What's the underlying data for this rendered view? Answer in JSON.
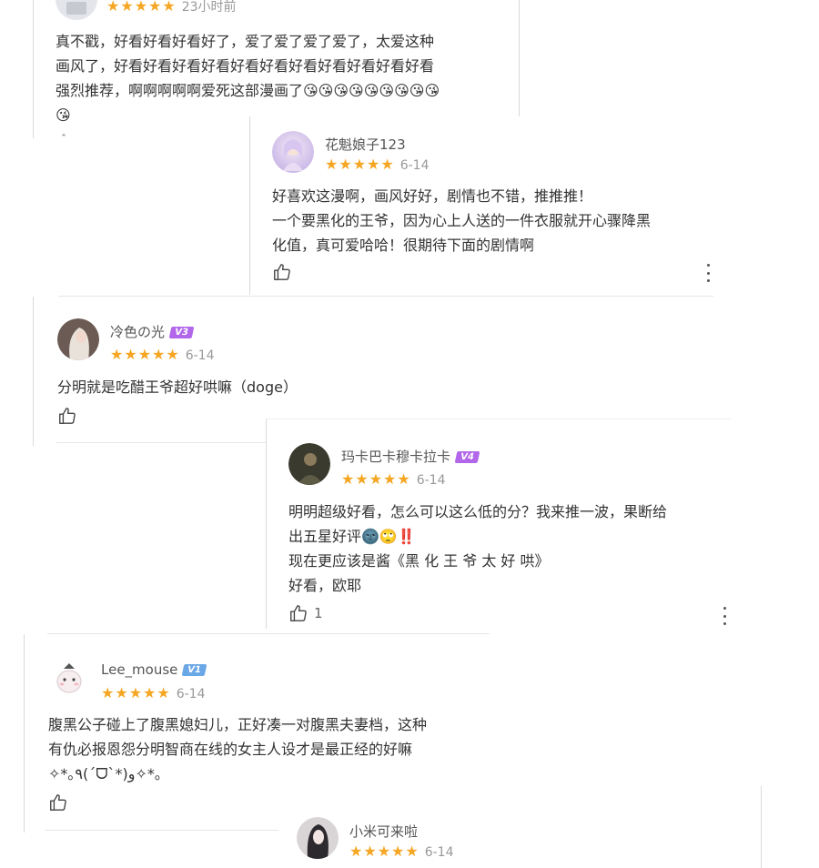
{
  "colors": {
    "star": "#f5a623",
    "vip3": "#b267ea",
    "vip4": "#b267ea",
    "vip1": "#6aa7e6"
  },
  "icons": {
    "star": "star-icon",
    "like": "thumb-up-icon",
    "more": "more-vertical-icon"
  },
  "reviews": [
    {
      "username": "",
      "stars": "★★★★★",
      "date": "23小时前",
      "text": "真不戳，好看好看好看好了，爱了爱了爱了爱了，太爱这种\n画风了，好看好看好看好看好看好看好看好看好看好看好看\n强烈推荐，啊啊啊啊啊爱死这部漫画了😘😘😘😘😘😘😘😘😘\n😘",
      "collapse": "ˆ"
    },
    {
      "username": "花魁娘子123",
      "stars": "★★★★★",
      "date": "6-14",
      "text": "好喜欢这漫啊，画风好好，剧情也不错，推推推！\n一个要黑化的王爷，因为心上人送的一件衣服就开心骤降黑\n化值，真可爱哈哈！很期待下面的剧情啊"
    },
    {
      "username": "冷色の光",
      "vip": "V3",
      "stars": "★★★★★",
      "date": "6-14",
      "text": "分明就是吃醋王爷超好哄嘛（doge）"
    },
    {
      "username": "玛卡巴卡穆卡拉卡",
      "vip": "V4",
      "stars": "★★★★★",
      "date": "6-14",
      "text": "明明超级好看，怎么可以这么低的分？我来推一波，果断给\n出五星好评🌚🙄‼️\n现在更应该是酱《黑 化 王 爷 太 好 哄》\n好看，欧耶",
      "likes": "1"
    },
    {
      "username": "Lee_mouse",
      "vip": "V1",
      "stars": "★★★★★",
      "date": "6-14",
      "text": "腹黑公子碰上了腹黑媳妇儿，正好凑一对腹黑夫妻档，这种\n有仇必报恩怨分明智商在线的女主人设才是最正经的好嘛\n✧*｡٩(ˊᗜˋ*)و✧*｡"
    },
    {
      "username": "小米可来啦",
      "stars": "★★★★★",
      "date": "6-14"
    }
  ]
}
